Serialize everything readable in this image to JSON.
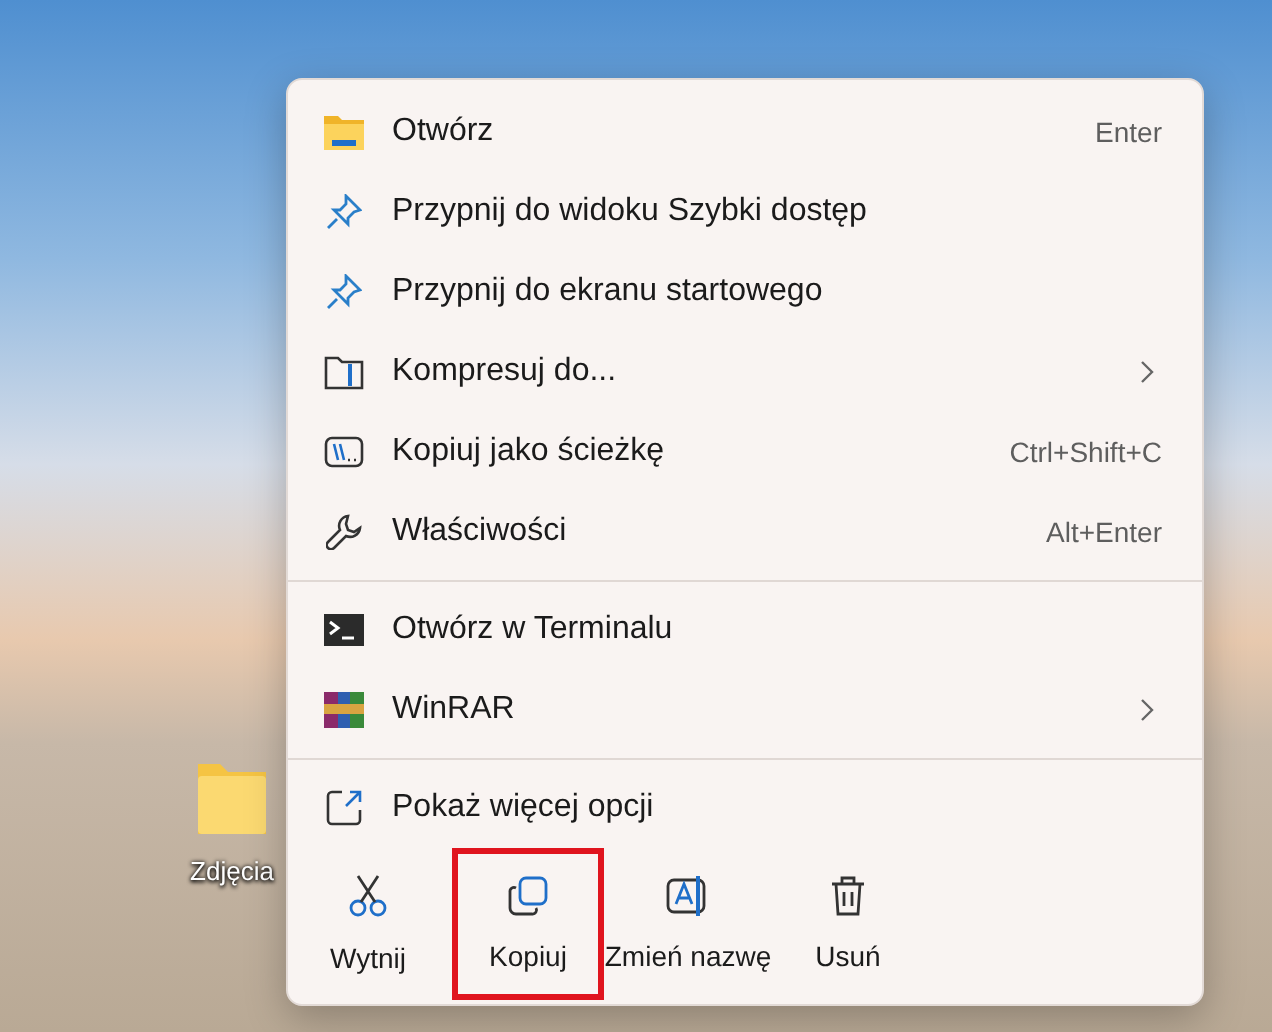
{
  "desktop_icons": [
    {
      "label": "Zdjęcia"
    }
  ],
  "context_menu": {
    "sections": [
      {
        "items": [
          {
            "label": "Otwórz",
            "shortcut": "Enter",
            "submenu": false
          },
          {
            "label": "Przypnij do widoku Szybki dostęp",
            "submenu": false
          },
          {
            "label": "Przypnij do ekranu startowego",
            "submenu": false
          },
          {
            "label": "Kompresuj do...",
            "submenu": true
          },
          {
            "label": "Kopiuj jako ścieżkę",
            "shortcut": "Ctrl+Shift+C",
            "submenu": false
          },
          {
            "label": "Właściwości",
            "shortcut": "Alt+Enter",
            "submenu": false
          }
        ]
      },
      {
        "items": [
          {
            "label": "Otwórz w Terminalu",
            "submenu": false
          },
          {
            "label": "WinRAR",
            "submenu": true
          }
        ]
      },
      {
        "items": [
          {
            "label": "Pokaż więcej opcji",
            "submenu": false
          }
        ]
      }
    ],
    "actions": [
      {
        "label": "Wytnij",
        "highlighted": false
      },
      {
        "label": "Kopiuj",
        "highlighted": true
      },
      {
        "label": "Zmień nazwę",
        "highlighted": false
      },
      {
        "label": "Usuń",
        "highlighted": false
      }
    ]
  }
}
